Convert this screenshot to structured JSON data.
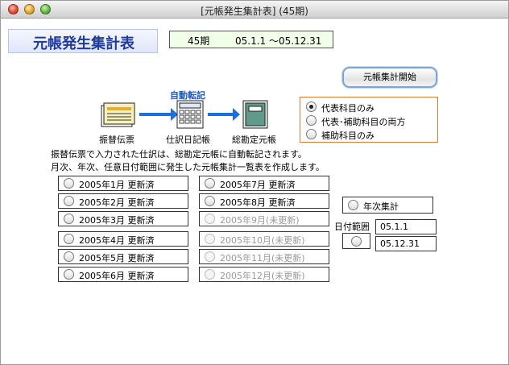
{
  "window": {
    "title": "[元帳発生集計表]  (45期)"
  },
  "header": {
    "title": "元帳発生集計表",
    "period_number": "45期",
    "period_range": "05.1.1 ～05.12.31"
  },
  "actions": {
    "start_button": "元帳集計開始"
  },
  "flow": {
    "source": "振替伝票",
    "arrow_label": "自動転記",
    "journal": "仕訳日記帳",
    "ledger": "総勘定元帳"
  },
  "account_mode": {
    "options": [
      {
        "label": "代表科目のみ",
        "selected": true
      },
      {
        "label": "代表･補助科目の両方",
        "selected": false
      },
      {
        "label": "補助科目のみ",
        "selected": false
      }
    ]
  },
  "description": [
    "振替伝票で入力された仕訳は、総勘定元帳に自動転記されます。",
    "月次、年次、任意日付範囲に発生した元帳集計一覧表を作成します。"
  ],
  "months": [
    {
      "label": "2005年1月 更新済",
      "enabled": true
    },
    {
      "label": "2005年2月 更新済",
      "enabled": true
    },
    {
      "label": "2005年3月 更新済",
      "enabled": true
    },
    {
      "label": "2005年4月 更新済",
      "enabled": true
    },
    {
      "label": "2005年5月 更新済",
      "enabled": true
    },
    {
      "label": "2005年6月 更新済",
      "enabled": true
    },
    {
      "label": "2005年7月 更新済",
      "enabled": true
    },
    {
      "label": "2005年8月 更新済",
      "enabled": true
    },
    {
      "label": "2005年9月(未更新)",
      "enabled": false
    },
    {
      "label": "2005年10月(未更新)",
      "enabled": false
    },
    {
      "label": "2005年11月(未更新)",
      "enabled": false
    },
    {
      "label": "2005年12月(未更新)",
      "enabled": false
    }
  ],
  "annual": {
    "label": "年次集計"
  },
  "date_range": {
    "label": "日付範囲",
    "from": "05.1.1",
    "to": "05.12.31"
  }
}
